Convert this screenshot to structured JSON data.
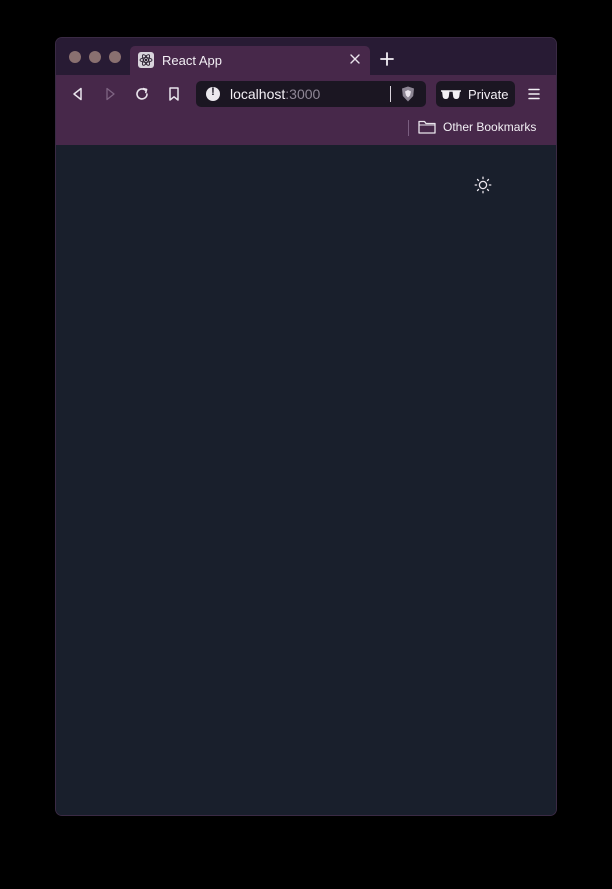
{
  "window": {
    "traffic_lights": [
      "close",
      "minimize",
      "maximize"
    ]
  },
  "tabs": [
    {
      "title": "React App",
      "favicon": "react-icon",
      "close_icon": "close-icon"
    }
  ],
  "new_tab_icon": "plus-icon",
  "toolbar": {
    "back_icon": "back-icon",
    "forward_icon": "forward-icon",
    "reload_icon": "reload-icon",
    "bookmark_icon": "bookmark-icon",
    "url_host": "localhost",
    "url_port": ":3000",
    "site_info_icon": "info-icon",
    "shield_icon": "brave-shield-icon",
    "private_label": "Private",
    "private_icon": "private-glasses-icon",
    "menu_icon": "hamburger-menu-icon"
  },
  "bookmarks_bar": {
    "other_bookmarks_label": "Other Bookmarks",
    "folder_icon": "folder-icon"
  },
  "page": {
    "theme_toggle_icon": "sun-icon",
    "background": "#191f2c"
  },
  "colors": {
    "toolbar": "#47284a",
    "tabstrip": "#281b34",
    "urlbar": "#1b1622"
  }
}
